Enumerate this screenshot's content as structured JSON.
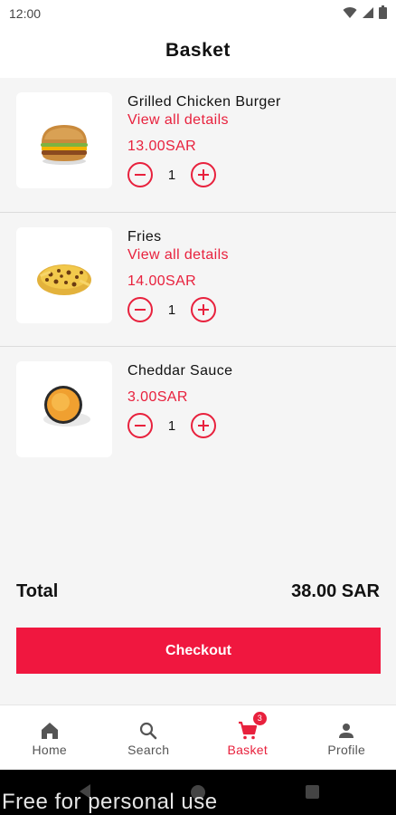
{
  "status_bar": {
    "time": "12:00"
  },
  "header": {
    "title": "Basket"
  },
  "basket": {
    "items": [
      {
        "name": "Grilled Chicken Burger",
        "details_link": "View all details",
        "price": "13.00SAR",
        "quantity": "1"
      },
      {
        "name": "Fries",
        "details_link": "View all details",
        "price": "14.00SAR",
        "quantity": "1"
      },
      {
        "name": "Cheddar Sauce",
        "price": "3.00SAR",
        "quantity": "1"
      }
    ]
  },
  "summary": {
    "total_label": "Total",
    "total_value": "38.00 SAR",
    "checkout_label": "Checkout"
  },
  "bottom_nav": {
    "items": [
      {
        "label": "Home",
        "icon": "home-icon"
      },
      {
        "label": "Search",
        "icon": "search-icon"
      },
      {
        "label": "Basket",
        "icon": "cart-icon",
        "badge": "3",
        "active": true
      },
      {
        "label": "Profile",
        "icon": "person-icon"
      }
    ]
  },
  "watermark": "Free for personal use",
  "colors": {
    "accent": "#e8213d",
    "checkout": "#f0173f",
    "background": "#f5f5f5"
  }
}
